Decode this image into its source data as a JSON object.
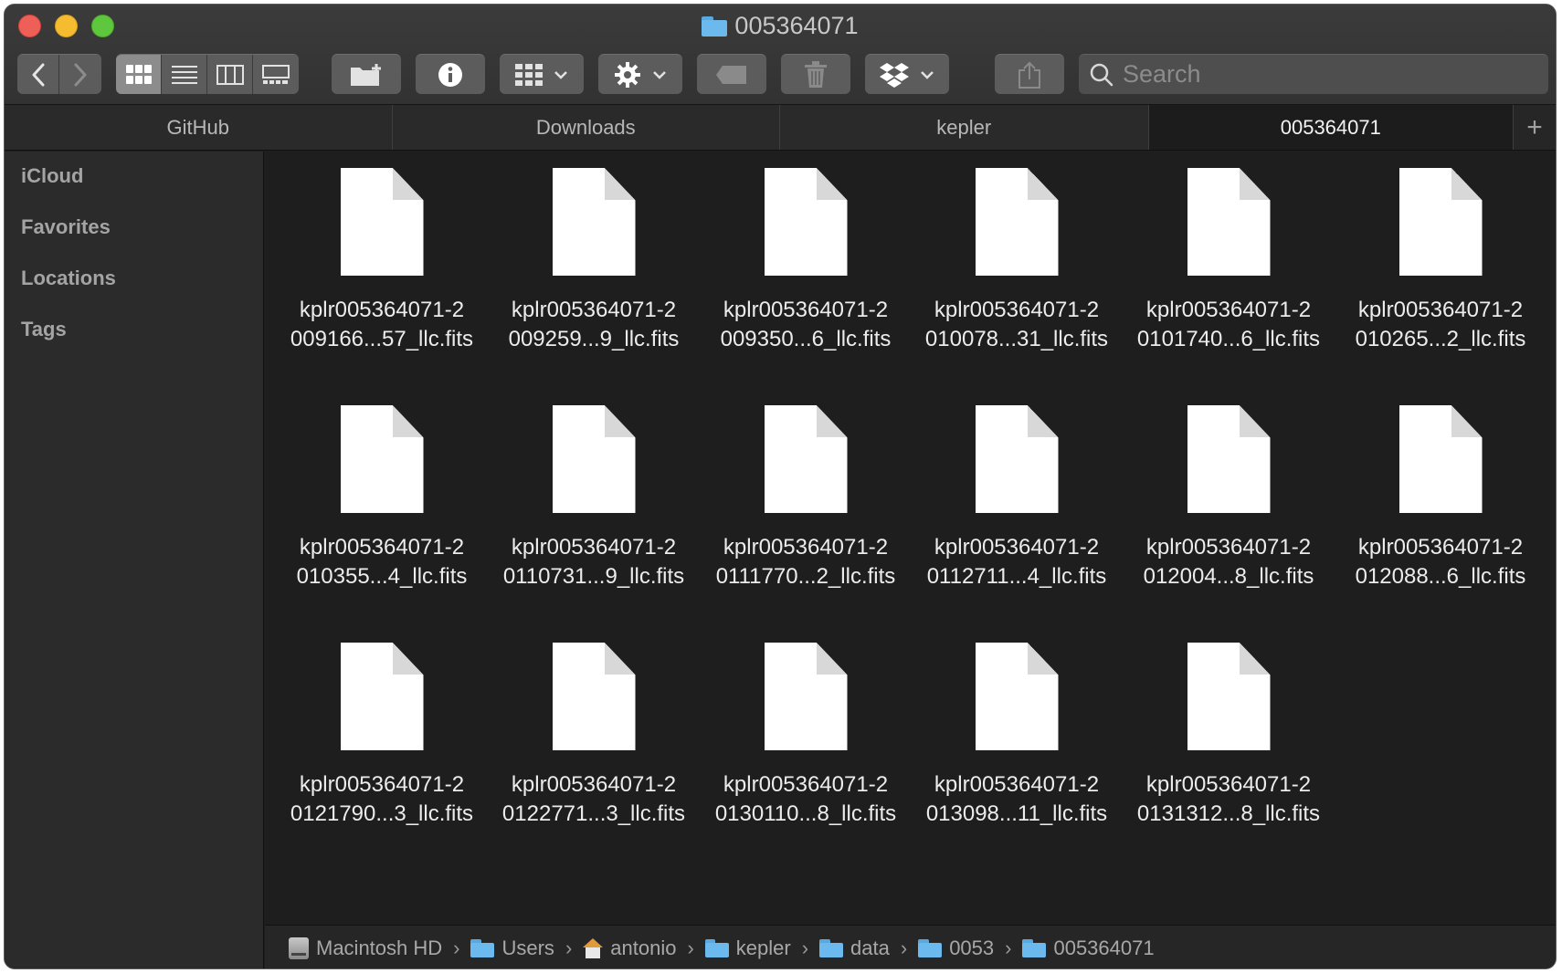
{
  "window": {
    "title": "005364071"
  },
  "toolbar": {
    "back_icon": "chevron-left-icon",
    "forward_icon": "chevron-right-icon",
    "view_modes": [
      "icon-view",
      "list-view",
      "column-view",
      "gallery-view"
    ],
    "active_view": "icon-view",
    "search_placeholder": "Search"
  },
  "tabs": [
    {
      "label": "GitHub",
      "active": false
    },
    {
      "label": "Downloads",
      "active": false
    },
    {
      "label": "kepler",
      "active": false
    },
    {
      "label": "005364071",
      "active": true
    }
  ],
  "sidebar": {
    "items": [
      {
        "label": "iCloud"
      },
      {
        "label": "Favorites"
      },
      {
        "label": "Locations"
      },
      {
        "label": "Tags"
      }
    ]
  },
  "files": [
    {
      "line1": "kplr005364071-2",
      "line2": "009166...57_llc.fits"
    },
    {
      "line1": "kplr005364071-2",
      "line2": "009259...9_llc.fits"
    },
    {
      "line1": "kplr005364071-2",
      "line2": "009350...6_llc.fits"
    },
    {
      "line1": "kplr005364071-2",
      "line2": "010078...31_llc.fits"
    },
    {
      "line1": "kplr005364071-2",
      "line2": "0101740...6_llc.fits"
    },
    {
      "line1": "kplr005364071-2",
      "line2": "010265...2_llc.fits"
    },
    {
      "line1": "kplr005364071-2",
      "line2": "010355...4_llc.fits"
    },
    {
      "line1": "kplr005364071-2",
      "line2": "0110731...9_llc.fits"
    },
    {
      "line1": "kplr005364071-2",
      "line2": "0111770...2_llc.fits"
    },
    {
      "line1": "kplr005364071-2",
      "line2": "0112711...4_llc.fits"
    },
    {
      "line1": "kplr005364071-2",
      "line2": "012004...8_llc.fits"
    },
    {
      "line1": "kplr005364071-2",
      "line2": "012088...6_llc.fits"
    },
    {
      "line1": "kplr005364071-2",
      "line2": "0121790...3_llc.fits"
    },
    {
      "line1": "kplr005364071-2",
      "line2": "0122771...3_llc.fits"
    },
    {
      "line1": "kplr005364071-2",
      "line2": "0130110...8_llc.fits"
    },
    {
      "line1": "kplr005364071-2",
      "line2": "013098...11_llc.fits"
    },
    {
      "line1": "kplr005364071-2",
      "line2": "0131312...8_llc.fits"
    }
  ],
  "pathbar": {
    "crumbs": [
      {
        "label": "Macintosh HD",
        "icon": "hard-drive-icon"
      },
      {
        "label": "Users",
        "icon": "folder-icon"
      },
      {
        "label": "antonio",
        "icon": "home-icon"
      },
      {
        "label": "kepler",
        "icon": "folder-icon"
      },
      {
        "label": "data",
        "icon": "folder-icon"
      },
      {
        "label": "0053",
        "icon": "folder-icon"
      },
      {
        "label": "005364071",
        "icon": "folder-icon"
      }
    ],
    "separator": "›"
  },
  "colors": {
    "window_bg": "#1e1e1e",
    "sidebar_bg": "#2b2b2b",
    "folder_blue": "#6cb9ee",
    "traffic_close": "#ee5f57",
    "traffic_min": "#f5bc2f",
    "traffic_max": "#5fc73d"
  }
}
